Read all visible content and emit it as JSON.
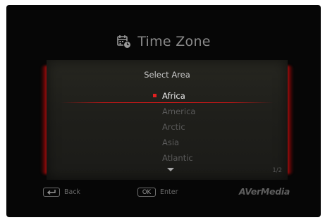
{
  "header": {
    "title": "Time Zone",
    "icon": "calendar-clock-icon"
  },
  "panel": {
    "heading": "Select Area",
    "items": [
      {
        "label": "Africa",
        "selected": true
      },
      {
        "label": "America",
        "selected": false
      },
      {
        "label": "Arctic",
        "selected": false
      },
      {
        "label": "Asia",
        "selected": false
      },
      {
        "label": "Atlantic",
        "selected": false
      }
    ],
    "page_indicator": "1/2",
    "more_icon": "arrow-down-icon",
    "selection_color": "#e22020"
  },
  "footer": {
    "back_label": "Back",
    "back_icon": "return-arrow-icon",
    "enter_key": "OK",
    "enter_label": "Enter",
    "brand": "AVerMedia"
  }
}
